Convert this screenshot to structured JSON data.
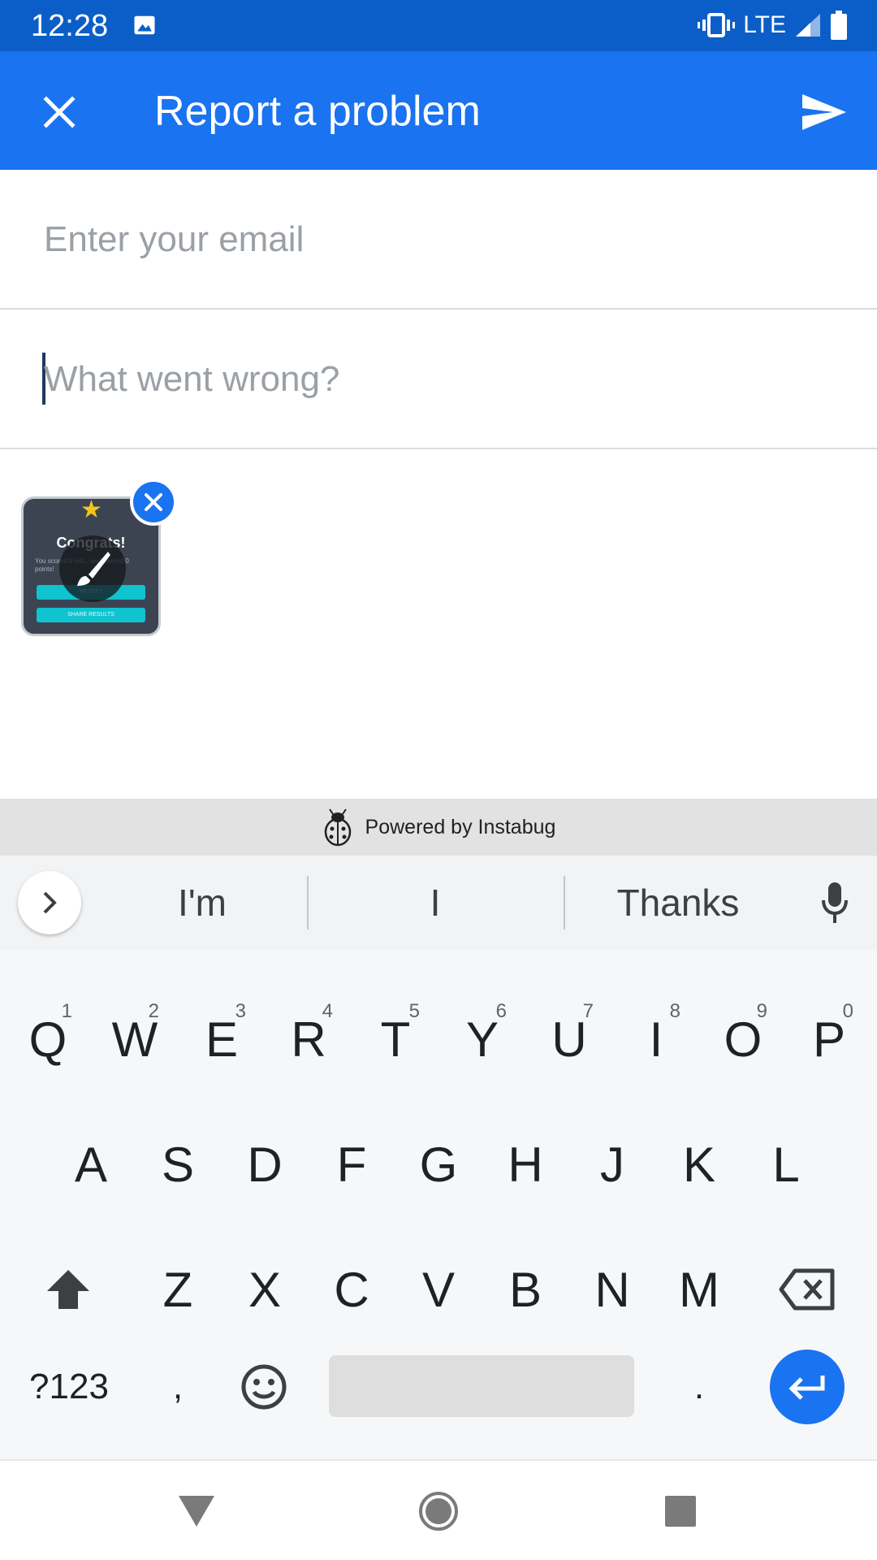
{
  "status_bar": {
    "time": "12:28",
    "network": "LTE",
    "icons": [
      "image-icon",
      "vibrate-icon",
      "signal-icon",
      "battery-icon"
    ]
  },
  "app_bar": {
    "title": "Report a problem",
    "close_icon": "close-icon",
    "send_icon": "send-icon",
    "color": "#1a73f0"
  },
  "form": {
    "email": {
      "value": "",
      "placeholder": "Enter your email"
    },
    "description": {
      "value": "",
      "placeholder": "What went wrong?"
    }
  },
  "attachment": {
    "thumbnail_title": "Congrats!",
    "thumbnail_text": "You scored 0 out... and earned 0 points!",
    "button_1": "RETRY?",
    "button_2": "SHARE RESULTS",
    "edit_icon": "brush-icon",
    "remove_icon": "close-icon"
  },
  "footer": {
    "powered_by": "Powered by Instabug",
    "logo_icon": "ladybug-icon"
  },
  "suggestions": {
    "items": [
      "I'm",
      "I",
      "Thanks"
    ],
    "expand_icon": "chevron-right-icon",
    "mic_icon": "mic-icon"
  },
  "keyboard": {
    "row1": [
      {
        "key": "Q",
        "hint": "1"
      },
      {
        "key": "W",
        "hint": "2"
      },
      {
        "key": "E",
        "hint": "3"
      },
      {
        "key": "R",
        "hint": "4"
      },
      {
        "key": "T",
        "hint": "5"
      },
      {
        "key": "Y",
        "hint": "6"
      },
      {
        "key": "U",
        "hint": "7"
      },
      {
        "key": "I",
        "hint": "8"
      },
      {
        "key": "O",
        "hint": "9"
      },
      {
        "key": "P",
        "hint": "0"
      }
    ],
    "row2": [
      "A",
      "S",
      "D",
      "F",
      "G",
      "H",
      "J",
      "K",
      "L"
    ],
    "row3": [
      "Z",
      "X",
      "C",
      "V",
      "B",
      "N",
      "M"
    ],
    "symbols_key": "?123",
    "comma_key": ",",
    "period_key": ".",
    "shift_icon": "shift-icon",
    "backspace_icon": "backspace-icon",
    "emoji_icon": "emoji-icon",
    "enter_icon": "enter-icon"
  },
  "nav_bar": {
    "icons": [
      "back-icon",
      "home-icon",
      "recents-icon"
    ]
  }
}
